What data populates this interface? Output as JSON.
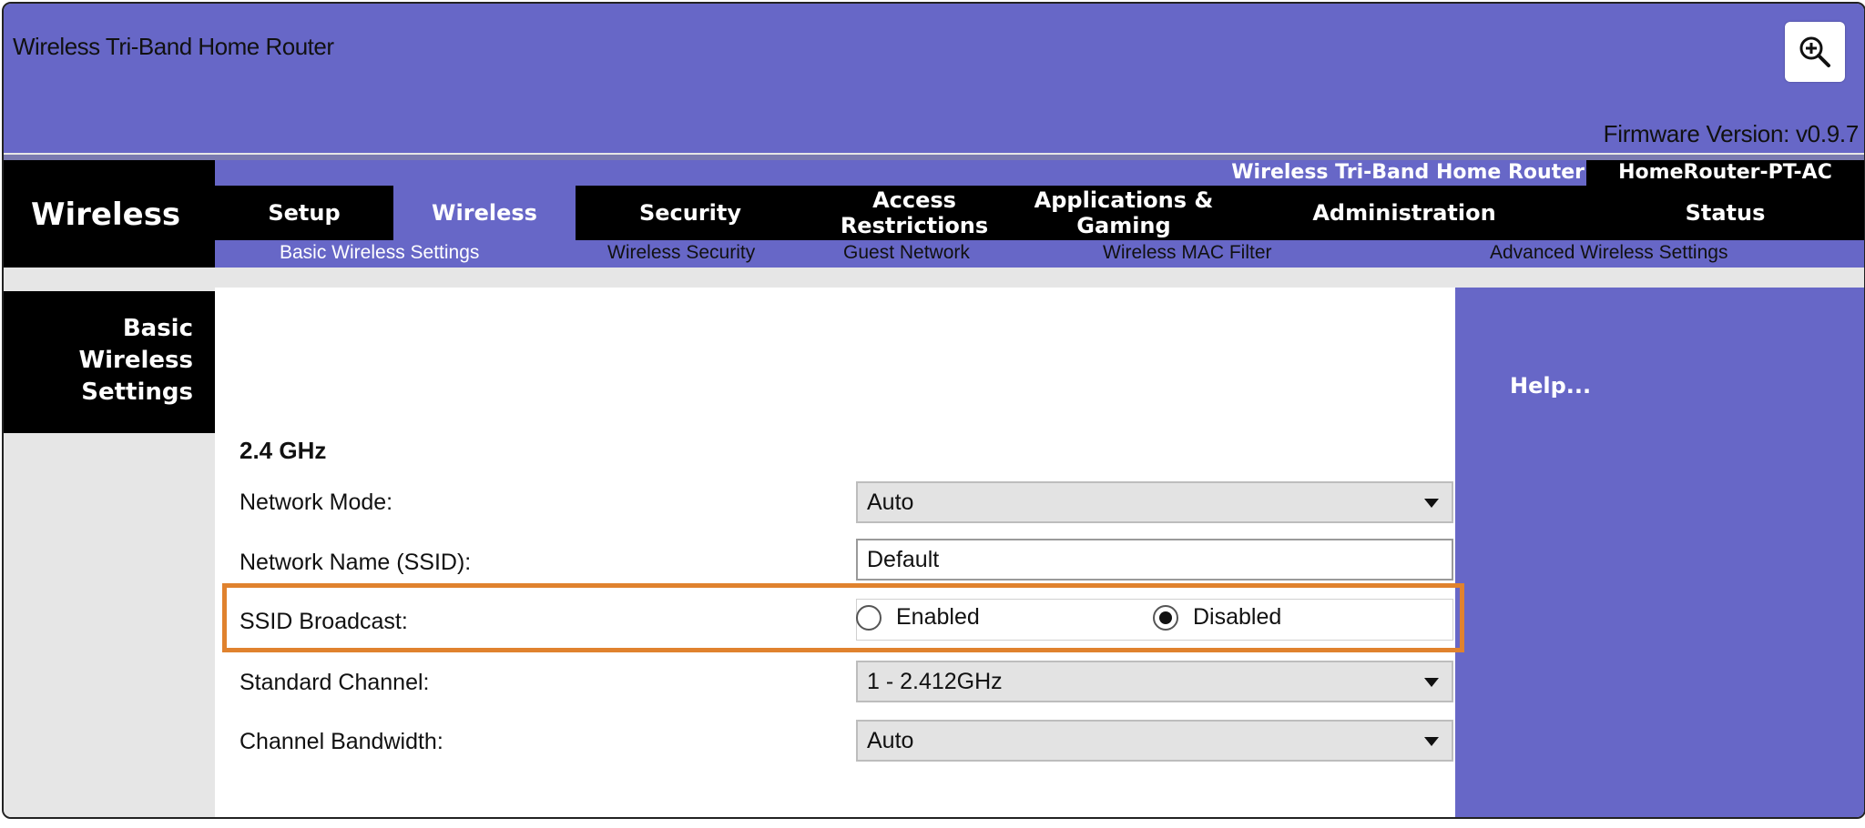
{
  "app": {
    "title": "Wireless Tri-Band Home Router",
    "firmware": "Firmware Version: v0.9.7"
  },
  "header": {
    "section_title": "Wireless",
    "product_name": "Wireless Tri-Band Home Router",
    "model": "HomeRouter-PT-AC"
  },
  "tabs": [
    {
      "label": "Setup"
    },
    {
      "label": "Wireless"
    },
    {
      "label": "Security"
    },
    {
      "label": "Access Restrictions"
    },
    {
      "label": "Applications & Gaming"
    },
    {
      "label": "Administration"
    },
    {
      "label": "Status"
    }
  ],
  "subtabs": [
    {
      "label": "Basic Wireless Settings"
    },
    {
      "label": "Wireless Security"
    },
    {
      "label": "Guest Network"
    },
    {
      "label": "Wireless MAC Filter"
    },
    {
      "label": "Advanced Wireless Settings"
    }
  ],
  "sidebar": {
    "title": "Basic Wireless Settings"
  },
  "help": {
    "label": "Help..."
  },
  "form": {
    "band": "2.4 GHz",
    "network_mode": {
      "label": "Network Mode:",
      "value": "Auto"
    },
    "ssid": {
      "label": "Network Name (SSID):",
      "value": "Default"
    },
    "ssid_broadcast": {
      "label": "SSID Broadcast:",
      "options": [
        "Enabled",
        "Disabled"
      ],
      "selected": "Disabled"
    },
    "standard_channel": {
      "label": "Standard Channel:",
      "value": "1 - 2.412GHz"
    },
    "channel_bandwidth": {
      "label": "Channel Bandwidth:",
      "value": "Auto"
    }
  },
  "colors": {
    "purple": "#6767c7",
    "black": "#000000",
    "highlight": "#e0822e"
  }
}
